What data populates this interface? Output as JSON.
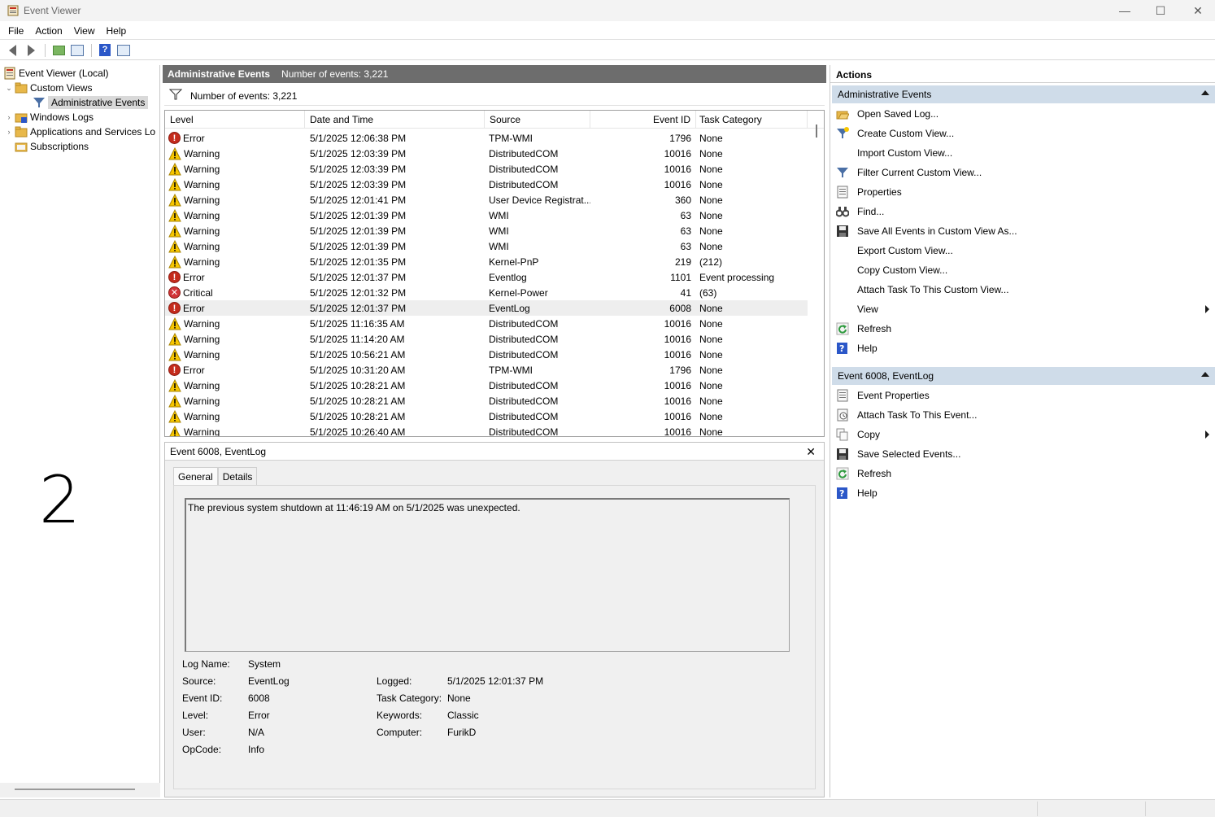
{
  "window": {
    "title": "Event Viewer",
    "minimize": "—",
    "maximize": "☐",
    "close": "✕"
  },
  "menu": [
    "File",
    "Action",
    "View",
    "Help"
  ],
  "tree": {
    "root": "Event Viewer (Local)",
    "custom_views": "Custom Views",
    "admin_events": "Administrative Events",
    "windows_logs": "Windows Logs",
    "apps_services": "Applications and Services Lo",
    "subscriptions": "Subscriptions"
  },
  "overlay_number": "2",
  "center": {
    "title": "Administrative Events",
    "count": "Number of events: 3,221",
    "filter_count": "Number of events: 3,221",
    "columns": [
      "Level",
      "Date and Time",
      "Source",
      "Event ID",
      "Task Category"
    ],
    "rows": [
      {
        "level": "Error",
        "date": "5/1/2025 12:06:38 PM",
        "source": "TPM-WMI",
        "id": "1796",
        "cat": "None"
      },
      {
        "level": "Warning",
        "date": "5/1/2025 12:03:39 PM",
        "source": "DistributedCOM",
        "id": "10016",
        "cat": "None"
      },
      {
        "level": "Warning",
        "date": "5/1/2025 12:03:39 PM",
        "source": "DistributedCOM",
        "id": "10016",
        "cat": "None"
      },
      {
        "level": "Warning",
        "date": "5/1/2025 12:03:39 PM",
        "source": "DistributedCOM",
        "id": "10016",
        "cat": "None"
      },
      {
        "level": "Warning",
        "date": "5/1/2025 12:01:41 PM",
        "source": "User Device Registrat...",
        "id": "360",
        "cat": "None"
      },
      {
        "level": "Warning",
        "date": "5/1/2025 12:01:39 PM",
        "source": "WMI",
        "id": "63",
        "cat": "None"
      },
      {
        "level": "Warning",
        "date": "5/1/2025 12:01:39 PM",
        "source": "WMI",
        "id": "63",
        "cat": "None"
      },
      {
        "level": "Warning",
        "date": "5/1/2025 12:01:39 PM",
        "source": "WMI",
        "id": "63",
        "cat": "None"
      },
      {
        "level": "Warning",
        "date": "5/1/2025 12:01:35 PM",
        "source": "Kernel-PnP",
        "id": "219",
        "cat": "(212)"
      },
      {
        "level": "Error",
        "date": "5/1/2025 12:01:37 PM",
        "source": "Eventlog",
        "id": "1101",
        "cat": "Event processing"
      },
      {
        "level": "Critical",
        "date": "5/1/2025 12:01:32 PM",
        "source": "Kernel-Power",
        "id": "41",
        "cat": "(63)"
      },
      {
        "level": "Error",
        "date": "5/1/2025 12:01:37 PM",
        "source": "EventLog",
        "id": "6008",
        "cat": "None",
        "selected": true
      },
      {
        "level": "Warning",
        "date": "5/1/2025 11:16:35 AM",
        "source": "DistributedCOM",
        "id": "10016",
        "cat": "None"
      },
      {
        "level": "Warning",
        "date": "5/1/2025 11:14:20 AM",
        "source": "DistributedCOM",
        "id": "10016",
        "cat": "None"
      },
      {
        "level": "Warning",
        "date": "5/1/2025 10:56:21 AM",
        "source": "DistributedCOM",
        "id": "10016",
        "cat": "None"
      },
      {
        "level": "Error",
        "date": "5/1/2025 10:31:20 AM",
        "source": "TPM-WMI",
        "id": "1796",
        "cat": "None"
      },
      {
        "level": "Warning",
        "date": "5/1/2025 10:28:21 AM",
        "source": "DistributedCOM",
        "id": "10016",
        "cat": "None"
      },
      {
        "level": "Warning",
        "date": "5/1/2025 10:28:21 AM",
        "source": "DistributedCOM",
        "id": "10016",
        "cat": "None"
      },
      {
        "level": "Warning",
        "date": "5/1/2025 10:28:21 AM",
        "source": "DistributedCOM",
        "id": "10016",
        "cat": "None"
      },
      {
        "level": "Warning",
        "date": "5/1/2025 10:26:40 AM",
        "source": "DistributedCOM",
        "id": "10016",
        "cat": "None"
      }
    ]
  },
  "detail": {
    "title": "Event 6008, EventLog",
    "close": "✕",
    "tab_general": "General",
    "tab_details": "Details",
    "message": "The previous system shutdown at 11:46:19 AM on 5/1/2025 was unexpected.",
    "props_left": [
      {
        "k": "Log Name:",
        "v": "System"
      },
      {
        "k": "Source:",
        "v": "EventLog"
      },
      {
        "k": "Event ID:",
        "v": "6008"
      },
      {
        "k": "Level:",
        "v": "Error"
      },
      {
        "k": "User:",
        "v": "N/A"
      },
      {
        "k": "OpCode:",
        "v": "Info"
      }
    ],
    "props_right": [
      {
        "k": "Logged:",
        "v": "5/1/2025 12:01:37 PM"
      },
      {
        "k": "Task Category:",
        "v": "None"
      },
      {
        "k": "Keywords:",
        "v": "Classic"
      },
      {
        "k": "Computer:",
        "v": "FurikD"
      }
    ]
  },
  "actions": {
    "title": "Actions",
    "section1": "Administrative Events",
    "items1": [
      {
        "label": "Open Saved Log...",
        "icon": "folder-open-icon"
      },
      {
        "label": "Create Custom View...",
        "icon": "create-filter-icon"
      },
      {
        "label": "Import Custom View...",
        "icon": ""
      },
      {
        "label": "Filter Current Custom View...",
        "icon": "filter-icon"
      },
      {
        "label": "Properties",
        "icon": "properties-icon"
      },
      {
        "label": "Find...",
        "icon": "binoculars-icon"
      },
      {
        "label": "Save All Events in Custom View As...",
        "icon": "save-icon"
      },
      {
        "label": "Export Custom View...",
        "icon": ""
      },
      {
        "label": "Copy Custom View...",
        "icon": ""
      },
      {
        "label": "Attach Task To This Custom View...",
        "icon": ""
      },
      {
        "label": "View",
        "icon": "",
        "submenu": true
      },
      {
        "label": "Refresh",
        "icon": "refresh-icon"
      },
      {
        "label": "Help",
        "icon": "help-icon"
      }
    ],
    "section2": "Event 6008, EventLog",
    "items2": [
      {
        "label": "Event Properties",
        "icon": "event-properties-icon"
      },
      {
        "label": "Attach Task To This Event...",
        "icon": "task-icon"
      },
      {
        "label": "Copy",
        "icon": "copy-icon",
        "submenu": true
      },
      {
        "label": "Save Selected Events...",
        "icon": "save-icon"
      },
      {
        "label": "Refresh",
        "icon": "refresh-icon"
      },
      {
        "label": "Help",
        "icon": "help-icon"
      }
    ]
  },
  "colors": {
    "header_bg": "#6d6d6d",
    "section_bg": "#cfdce9",
    "error": "#c42b1c",
    "warning": "#f7c600"
  }
}
